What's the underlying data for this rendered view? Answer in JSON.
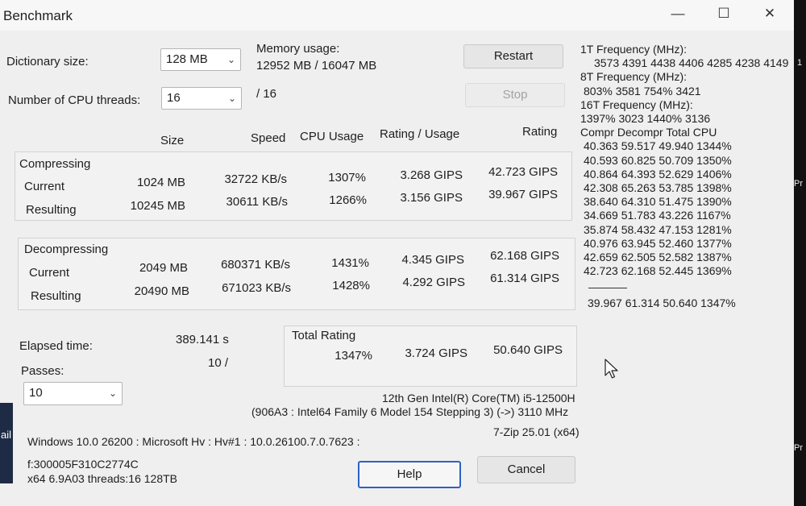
{
  "window": {
    "title": "Benchmark",
    "minimize": "—",
    "maximize": "☐",
    "close": "✕"
  },
  "settings": {
    "dict_label": "Dictionary size:",
    "dict_value": "128 MB",
    "threads_label": "Number of CPU threads:",
    "threads_value": "16",
    "threads_suffix": "/ 16",
    "mem_label": "Memory usage:",
    "mem_value": "12952 MB / 16047 MB"
  },
  "buttons": {
    "restart": "Restart",
    "stop": "Stop",
    "help": "Help",
    "cancel": "Cancel"
  },
  "headers": {
    "size": "Size",
    "speed": "Speed",
    "cpu": "CPU Usage",
    "rating_usage": "Rating / Usage",
    "rating": "Rating"
  },
  "compressing": {
    "title": "Compressing",
    "rows": [
      {
        "label": "Current",
        "size": "1024 MB",
        "speed": "32722 KB/s",
        "cpu": "1307%",
        "ru": "3.268 GIPS",
        "rating": "42.723 GIPS"
      },
      {
        "label": "Resulting",
        "size": "10245 MB",
        "speed": "30611 KB/s",
        "cpu": "1266%",
        "ru": "3.156 GIPS",
        "rating": "39.967 GIPS"
      }
    ]
  },
  "decompressing": {
    "title": "Decompressing",
    "rows": [
      {
        "label": "Current",
        "size": "2049 MB",
        "speed": "680371 KB/s",
        "cpu": "1431%",
        "ru": "4.345 GIPS",
        "rating": "62.168 GIPS"
      },
      {
        "label": "Resulting",
        "size": "20490 MB",
        "speed": "671023 KB/s",
        "cpu": "1428%",
        "ru": "4.292 GIPS",
        "rating": "61.314 GIPS"
      }
    ]
  },
  "elapsed": {
    "label": "Elapsed time:",
    "value": "389.141 s"
  },
  "passes": {
    "label": "Passes:",
    "value": "10 /",
    "select": "10"
  },
  "total": {
    "title": "Total Rating",
    "cpu": "1347%",
    "ru": "3.724 GIPS",
    "rating": "50.640 GIPS"
  },
  "cpu_info": {
    "line1": "12th Gen Intel(R) Core(TM) i5-12500H",
    "line2": "(906A3 : Intel64 Family 6 Model 154 Stepping 3) (->) 3110 MHz",
    "version": "7-Zip 25.01 (x64)"
  },
  "sys_info": {
    "line1": "Windows 10.0 26200 : Microsoft Hv : Hv#1 : 10.0.26100.7.0.7623 :",
    "line2": "f:300005F310C2774C",
    "line3": "x64 6.9A03 threads:16 128TB"
  },
  "right_panel": {
    "f1_label": "1T Frequency (MHz):",
    "f1_values": "3573 4391 4438 4406 4285 4238 4149",
    "f8_label": "8T Frequency (MHz):",
    "f8_values": "803% 3581 754% 3421",
    "f16_label": "16T Frequency (MHz):",
    "f16_values": "1397% 3023 1440% 3136",
    "table_header": "Compr Decompr Total  CPU",
    "rows": [
      "40.363  59.517  49.940  1344%",
      "40.593  60.825  50.709  1350%",
      "40.864  64.393  52.629  1406%",
      "42.308  65.263  53.785  1398%",
      "38.640  64.310  51.475  1390%",
      "34.669  51.783  43.226  1167%",
      "35.874  58.432  47.153  1281%",
      "40.976  63.945  52.460  1377%",
      "42.659  62.505  52.582  1387%",
      "42.723  62.168  52.445  1369%"
    ],
    "total_row": "39.967  61.314  50.640  1347%"
  },
  "edge": {
    "left_text": "ail",
    "right_top": "1",
    "right_mid": "Pr",
    "right_bottom": "Pr"
  }
}
